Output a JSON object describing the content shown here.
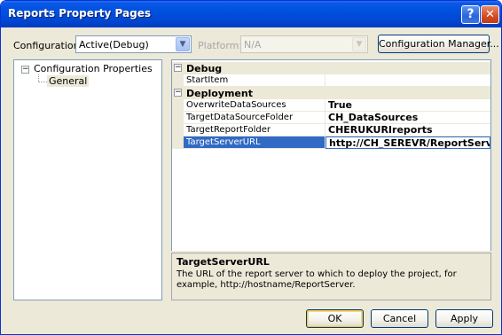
{
  "window": {
    "title": "Reports Property Pages",
    "help_icon": "question-mark-icon",
    "close_icon": "close-icon"
  },
  "toolbar": {
    "configuration_label": "Configuration:",
    "configuration_value": "Active(Debug)",
    "platform_label": "Platform:",
    "platform_value": "N/A",
    "configuration_manager_label": "Configuration Manager..."
  },
  "tree": {
    "root": "Configuration Properties",
    "child": "General"
  },
  "grid": {
    "categories": [
      {
        "name": "Debug",
        "properties": [
          {
            "name": "StartItem",
            "value": ""
          }
        ]
      },
      {
        "name": "Deployment",
        "properties": [
          {
            "name": "OverwriteDataSources",
            "value": "True"
          },
          {
            "name": "TargetDataSourceFolder",
            "value": "CH_DataSources"
          },
          {
            "name": "TargetReportFolder",
            "value": "CHERUKURIreports"
          },
          {
            "name": "TargetServerURL",
            "value": "http://CH_SEREVR/ReportServer"
          }
        ]
      }
    ],
    "selected_property": "TargetServerURL"
  },
  "description": {
    "title": "TargetServerURL",
    "text": "The URL of the report server to which to deploy the project, for example, http://hostname/ReportServer."
  },
  "buttons": {
    "ok": "OK",
    "cancel": "Cancel",
    "apply": "Apply"
  },
  "colors": {
    "title_bar": "#0050e0",
    "window_bg": "#ece9d8",
    "selection": "#316ac5"
  }
}
